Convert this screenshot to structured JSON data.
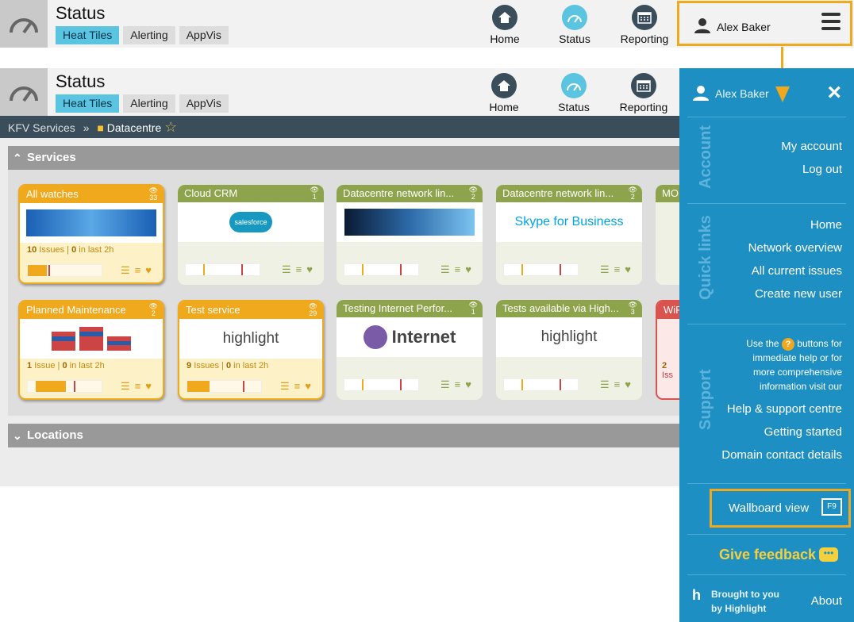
{
  "app": {
    "title": "Status",
    "tabs": [
      {
        "label": "Heat Tiles",
        "active": true
      },
      {
        "label": "Alerting"
      },
      {
        "label": "AppVis"
      }
    ],
    "nav": [
      {
        "label": "Home",
        "icon": "home-icon"
      },
      {
        "label": "Status",
        "icon": "gauge-icon"
      },
      {
        "label": "Reporting",
        "icon": "calendar-icon"
      }
    ],
    "user": "Alex Baker"
  },
  "breadcrumb": {
    "root": "KFV Services",
    "separator": "»",
    "current": "Datacentre"
  },
  "sections": {
    "services": "Services",
    "locations": "Locations"
  },
  "tiles": [
    {
      "title": "All watches",
      "count": "33",
      "style": "orange",
      "issues": "10",
      "issues_label": "Issues",
      "recent": "0",
      "recent_label": "in last 2h",
      "image": "world-map"
    },
    {
      "title": "Cloud CRM",
      "count": "1",
      "style": "green",
      "image": "salesforce",
      "image_text": "salesforce"
    },
    {
      "title": "Datacentre network lin...",
      "count": "2",
      "style": "green",
      "image": "network-globe"
    },
    {
      "title": "Datacentre network lin...",
      "count": "2",
      "style": "green",
      "image": "skype",
      "image_text": "Skype for Business"
    },
    {
      "title": "MO",
      "count": "",
      "style": "green",
      "image": "partial"
    },
    {
      "title": "Planned Maintenance",
      "count": "2",
      "style": "orange",
      "issues": "1",
      "issues_label": "Issue",
      "recent": "0",
      "recent_label": "in last 2h",
      "image": "stacked-bars"
    },
    {
      "title": "Test service",
      "count": "29",
      "style": "orange",
      "issues": "9",
      "issues_label": "Issues",
      "recent": "0",
      "recent_label": "in last 2h",
      "image": "highlight",
      "image_text": "highlight"
    },
    {
      "title": "Testing Internet Perfor...",
      "count": "1",
      "style": "green",
      "image": "internet",
      "image_text": "Internet"
    },
    {
      "title": "Tests available via High...",
      "count": "3",
      "style": "green",
      "image": "highlight",
      "image_text": "highlight"
    },
    {
      "title": "WiF",
      "count": "",
      "style": "red",
      "issues": "2",
      "issues_label": "Iss",
      "image": "wifi"
    }
  ],
  "panel": {
    "user": "Alex Baker",
    "close": "×",
    "account_label": "Account",
    "account_links": [
      "My account",
      "Log out"
    ],
    "quicklinks_label": "Quick links",
    "quick_links": [
      "Home",
      "Network overview",
      "All current issues",
      "Create new user"
    ],
    "support_label": "Support",
    "support_text_1": "Use the",
    "support_text_2": "buttons for immediate help or for more comprehensive information visit our",
    "support_links": [
      "Help & support centre",
      "Getting started",
      "Domain contact details"
    ],
    "wallboard": "Wallboard view",
    "wallboard_key": "F9",
    "feedback": "Give feedback",
    "brought_1": "Brought to you",
    "brought_2": "by Highlight",
    "about": "About"
  },
  "colors": {
    "accent": "#f0a81d",
    "panel": "#1e8fc3",
    "active_tab": "#5bc4e1",
    "tile_green": "#8ea44c",
    "breadcrumb_bg": "#3a4d5a"
  }
}
